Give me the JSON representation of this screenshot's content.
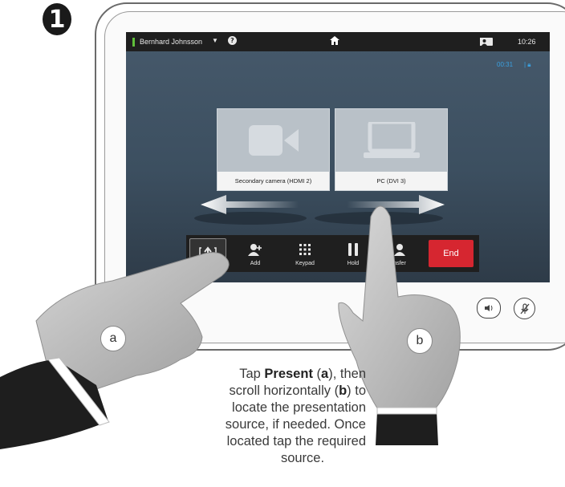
{
  "step": {
    "number": "1"
  },
  "status_bar": {
    "caller_name": "Bernhard Johnsson",
    "caret": "▼",
    "help_icon": "?",
    "home_icon": "home-icon",
    "clock": "10:26"
  },
  "call": {
    "timer": "00:31",
    "lock_icon": "lock-icon"
  },
  "sources": [
    {
      "label": "Secondary camera (HDMI 2)",
      "icon": "video-camera-icon"
    },
    {
      "label": "PC (DVI 3)",
      "icon": "laptop-icon"
    }
  ],
  "toolbar": {
    "present_icon": "present-icon",
    "add_label": "Add",
    "keypad_label": "Keypad",
    "hold_label": "Hold",
    "transfer_label": "nsfer",
    "end_label": "End"
  },
  "hand_labels": {
    "a": "a",
    "b": "b"
  },
  "caption": {
    "tap": "Tap ",
    "present": "Present",
    "paren_open_a": " (",
    "a": "a",
    "paren_close_then": "), then",
    "scroll": "scroll horizontally (",
    "b": "b",
    "paren_close_to": ") to",
    "line3": "locate the presentation",
    "line4": "source, if needed. Once",
    "line5": "located tap the required",
    "line6": "source."
  },
  "colors": {
    "end_red": "#d62630",
    "accent_blue": "#3aa0e0",
    "status_green": "#5fbf3a"
  }
}
